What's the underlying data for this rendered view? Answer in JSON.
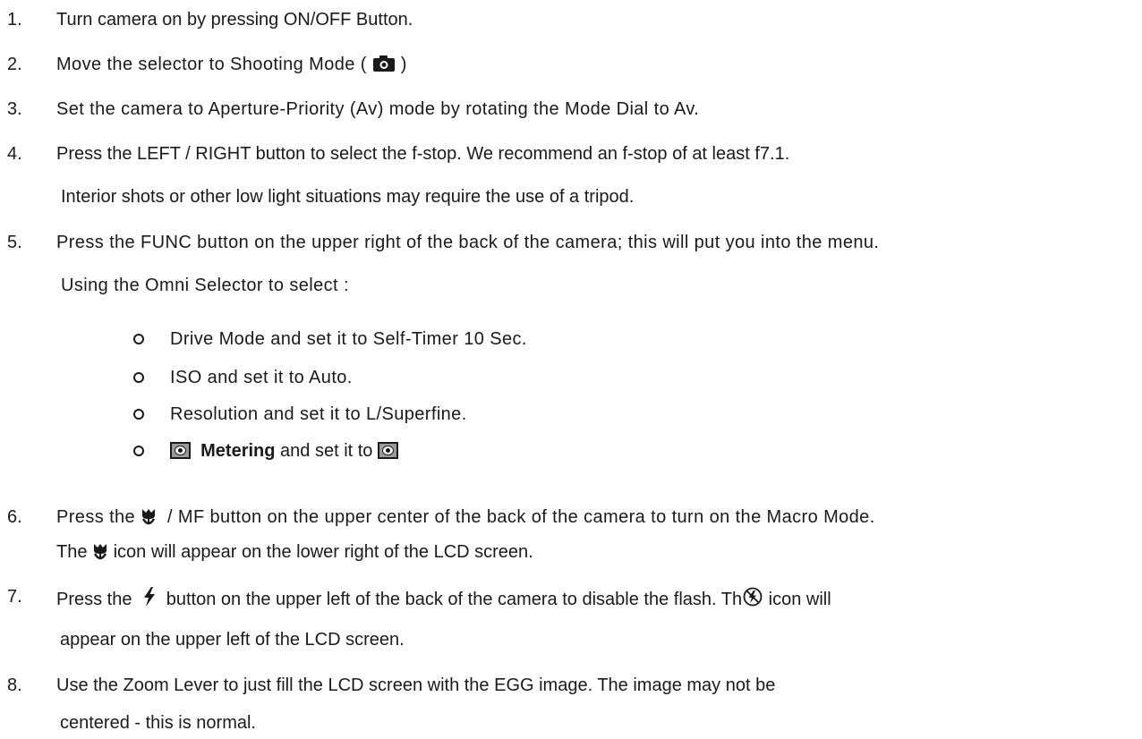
{
  "steps": [
    {
      "num": "1.",
      "parts": [
        "Turn camera on by pressing ON/OFF Button."
      ]
    },
    {
      "num": "2.",
      "parts": [
        "Move the selector to Shooting Mode (",
        ")"
      ]
    },
    {
      "num": "3.",
      "parts": [
        "Set the camera to Aperture-Priority (Av) mode by rotating the Mode Dial to Av."
      ]
    },
    {
      "num": "4.",
      "parts": [
        "Press the LEFT / RIGHT button to select the f-stop. We recommend an f-stop of at least f7.1."
      ],
      "cont": "Interior shots or other low light situations may require the use of a tripod."
    },
    {
      "num": "5.",
      "parts": [
        "Press the FUNC button on the upper right of the back of the camera; this will put you into the menu."
      ],
      "cont": "Using the Omni Selector to select :"
    },
    {
      "num": "6.",
      "parts": [
        "Press the ",
        " / MF button on the upper center of the back of the camera to turn on the Macro Mode."
      ],
      "cont_parts": [
        "The ",
        "  icon will appear on the lower right of the LCD screen."
      ]
    },
    {
      "num": "7.",
      "parts": [
        "Press the ",
        " button on the upper left of the back of the camera to disable the flash. Th",
        "  icon will"
      ],
      "cont": "appear on the upper left of the LCD screen."
    },
    {
      "num": "8.",
      "parts": [
        "Use the Zoom Lever to just fill the LCD screen with the EGG image. The image may not be"
      ],
      "cont": "centered - this is normal."
    }
  ],
  "bullets": [
    "Drive Mode and set it to Self-Timer 10 Sec.",
    "ISO and set it to Auto.",
    "Resolution and set it to L/Superfine."
  ],
  "metering": {
    "bold": "Metering",
    "rest": " and set it to "
  },
  "icons": {
    "camera": "camera-icon",
    "macro": "macro-flower-icon",
    "flash": "flash-icon",
    "flash_off": "flash-off-icon",
    "metering": "evaluative-metering-icon"
  }
}
